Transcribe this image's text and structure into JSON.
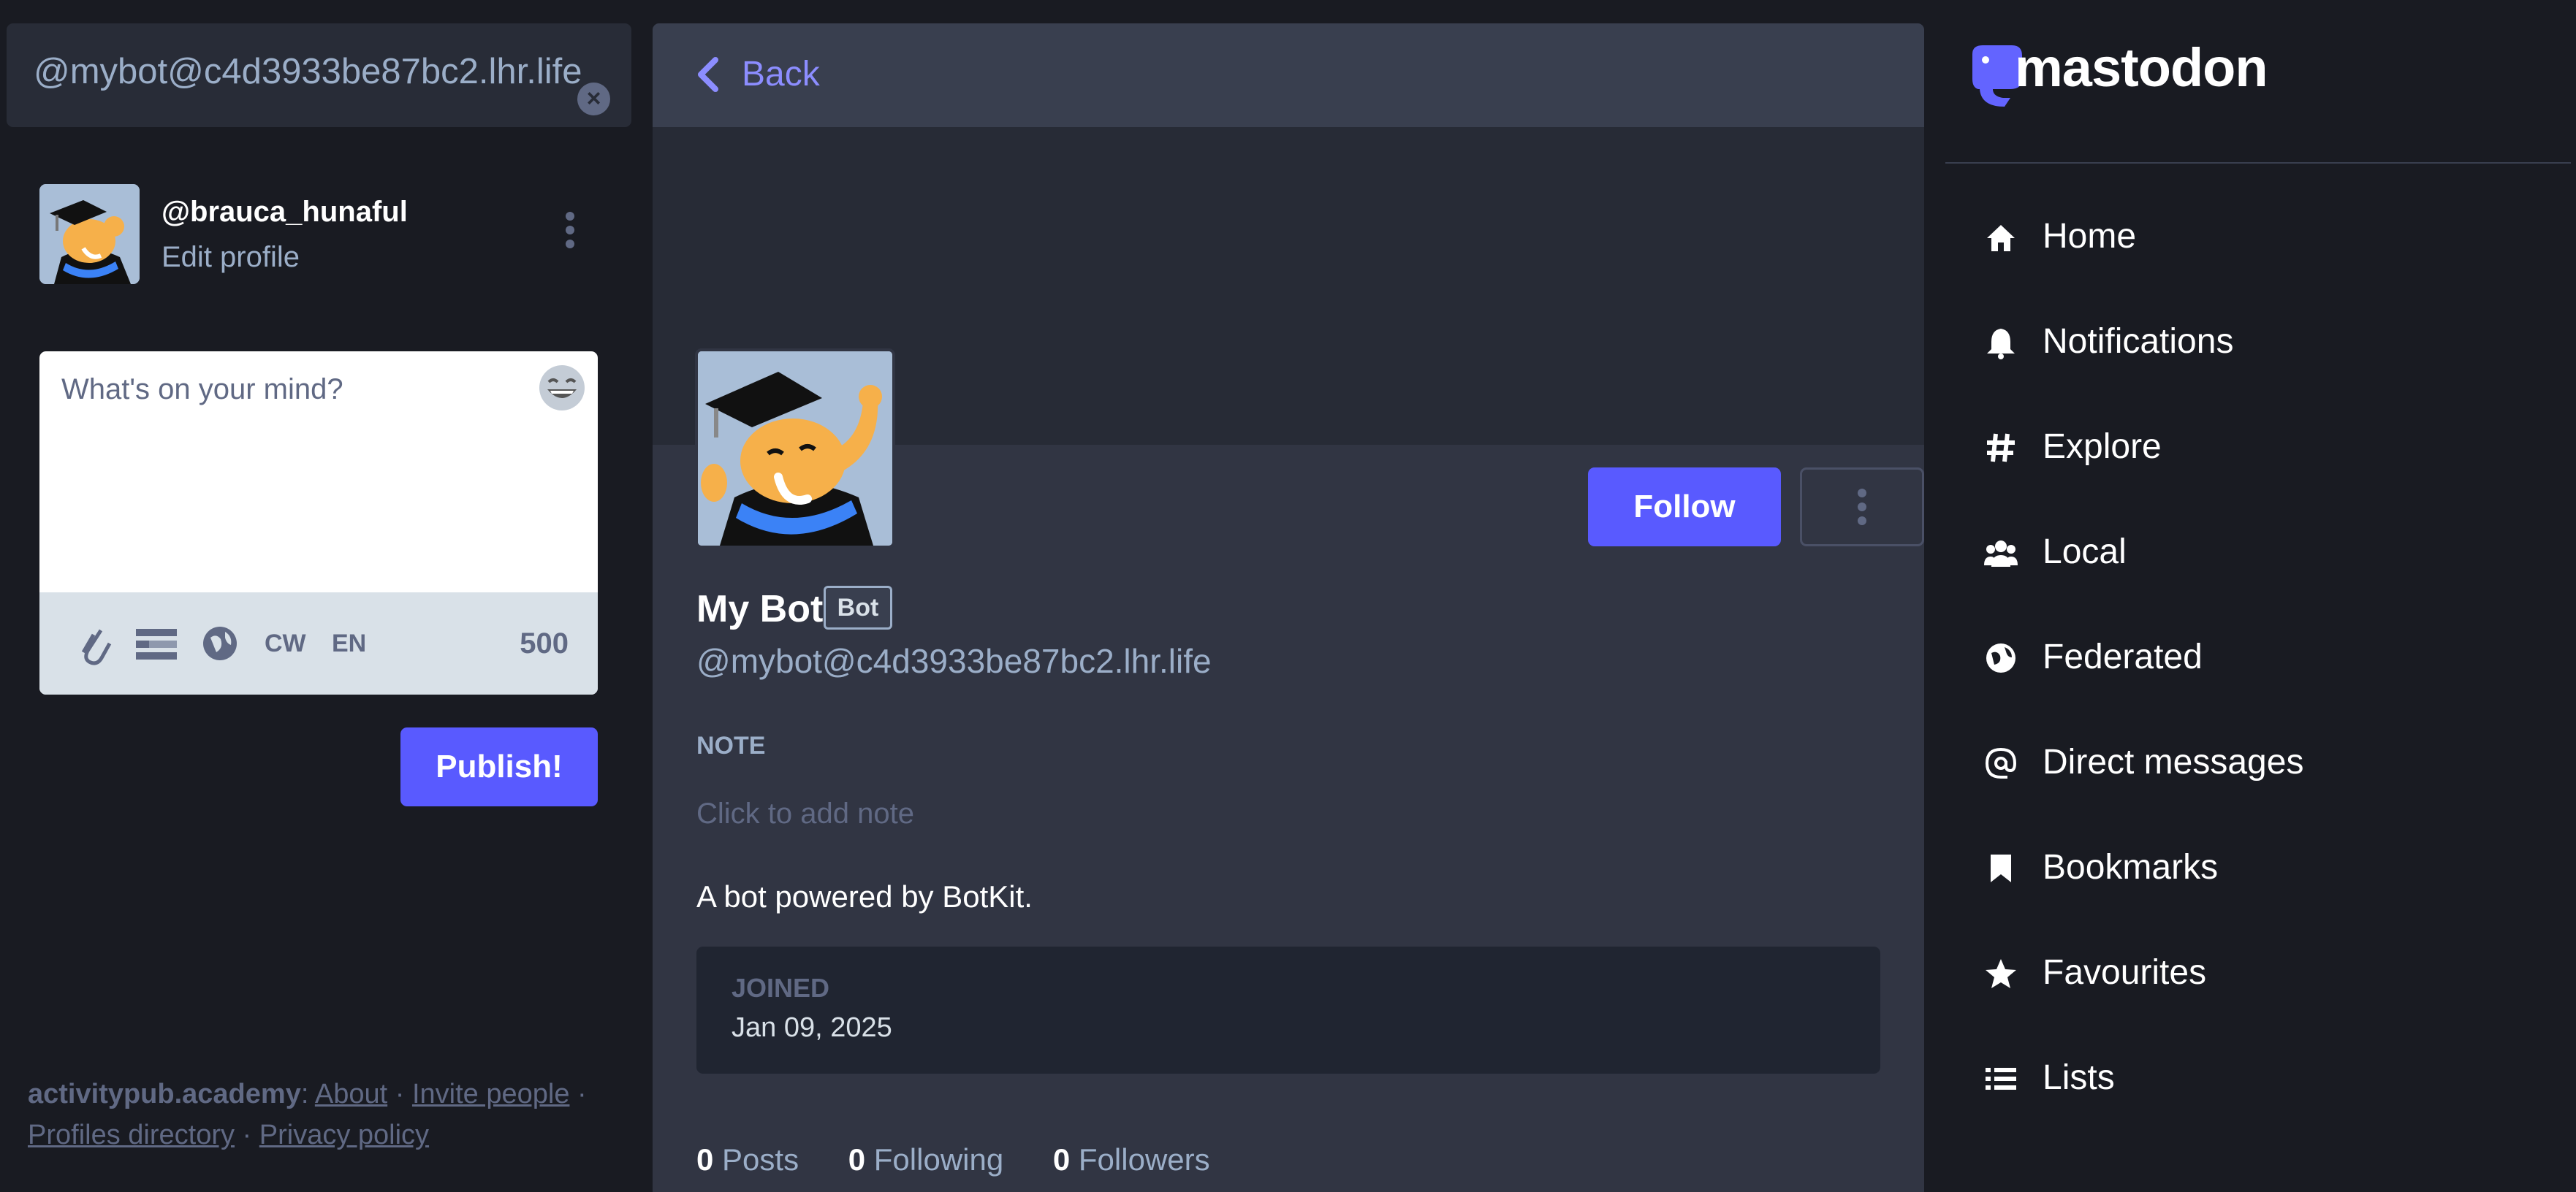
{
  "search": {
    "value": "@mybot@c4d3933be87bc2.lhr.life",
    "clear_icon": "close-circle-icon"
  },
  "me": {
    "handle": "@brauca_hunaful",
    "edit_label": "Edit profile"
  },
  "compose": {
    "placeholder": "What's on your mind?",
    "cw_label": "CW",
    "lang_label": "EN",
    "char_count": "500",
    "publish_label": "Publish!"
  },
  "footer": {
    "server": "activitypub.academy",
    "separator": ":",
    "dot": "·",
    "links": [
      "About",
      "Invite people",
      "Profiles directory",
      "Privacy policy"
    ]
  },
  "column": {
    "back_label": "Back"
  },
  "profile": {
    "display_name": "My Bot",
    "bot_badge": "Bot",
    "handle": "@mybot@c4d3933be87bc2.lhr.life",
    "follow_label": "Follow",
    "note_label": "NOTE",
    "note_placeholder": "Click to add note",
    "bio": "A bot powered by BotKit.",
    "joined_label": "JOINED",
    "joined_value": "Jan 09, 2025",
    "counts": [
      {
        "value": "0",
        "label": "Posts"
      },
      {
        "value": "0",
        "label": "Following"
      },
      {
        "value": "0",
        "label": "Followers"
      }
    ]
  },
  "brand": {
    "name": "mastodon"
  },
  "nav": [
    {
      "label": "Home",
      "icon": "home-icon"
    },
    {
      "label": "Notifications",
      "icon": "bell-icon"
    },
    {
      "label": "Explore",
      "icon": "hashtag-icon"
    },
    {
      "label": "Local",
      "icon": "users-icon"
    },
    {
      "label": "Federated",
      "icon": "globe-icon"
    },
    {
      "label": "Direct messages",
      "icon": "at-icon"
    },
    {
      "label": "Bookmarks",
      "icon": "bookmark-icon"
    },
    {
      "label": "Favourites",
      "icon": "star-icon"
    },
    {
      "label": "Lists",
      "icon": "list-icon"
    }
  ],
  "colors": {
    "accent": "#595aff",
    "link": "#8c8dff",
    "background": "#191b22",
    "panel": "#313543"
  }
}
